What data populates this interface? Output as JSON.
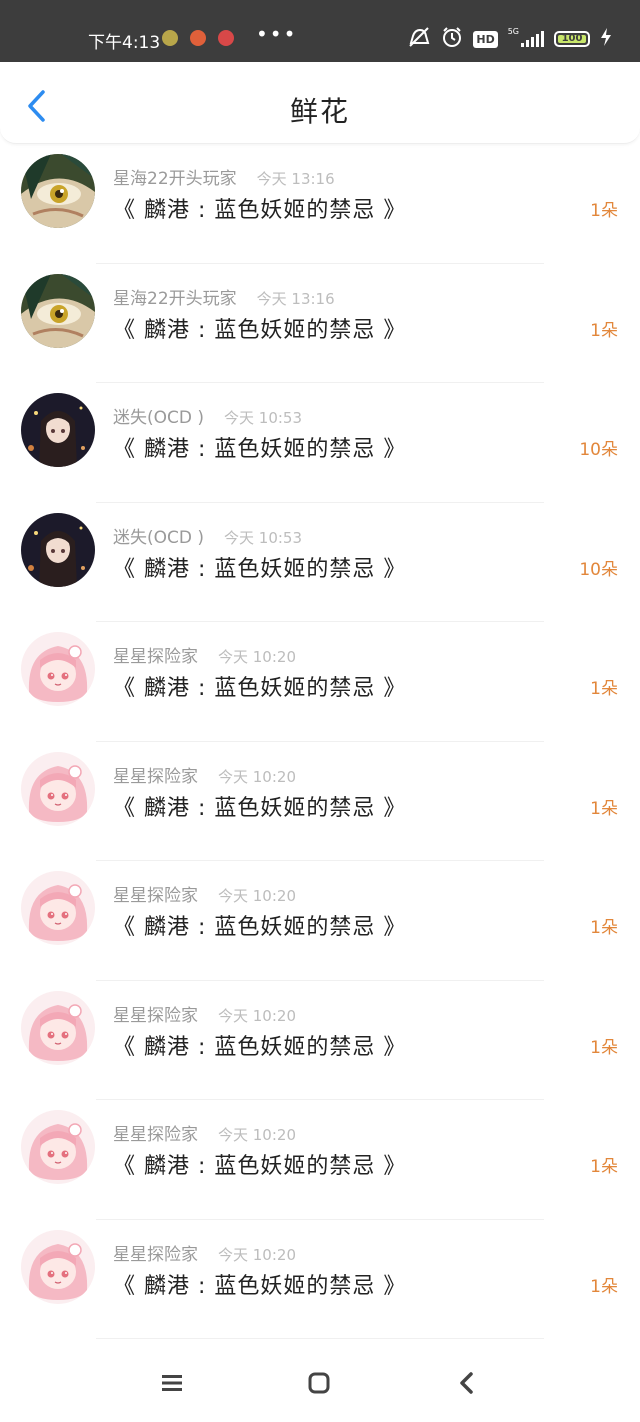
{
  "status_bar": {
    "time": "下午4:13",
    "more": "•••",
    "hd_label": "HD",
    "network_label": "5G",
    "battery_level": "100"
  },
  "header": {
    "title": "鲜花",
    "back_icon": "chevron-left-icon",
    "accent_color": "#2d8cf0"
  },
  "gifts": [
    {
      "user": "星海22开头玩家",
      "time": "今天 13:16",
      "book": "《 麟港 : 蓝色妖姬的禁忌 》",
      "count": "1朵",
      "avatar": "anime-eye"
    },
    {
      "user": "星海22开头玩家",
      "time": "今天 13:16",
      "book": "《 麟港 : 蓝色妖姬的禁忌 》",
      "count": "1朵",
      "avatar": "anime-eye"
    },
    {
      "user": "迷失(OCD )",
      "time": "今天 10:53",
      "book": "《 麟港 : 蓝色妖姬的禁忌 》",
      "count": "10朵",
      "avatar": "dark-hair-girl"
    },
    {
      "user": "迷失(OCD )",
      "time": "今天 10:53",
      "book": "《 麟港 : 蓝色妖姬的禁忌 》",
      "count": "10朵",
      "avatar": "dark-hair-girl"
    },
    {
      "user": "星星探险家",
      "time": "今天 10:20",
      "book": "《 麟港 : 蓝色妖姬的禁忌 》",
      "count": "1朵",
      "avatar": "pink-hair-girl"
    },
    {
      "user": "星星探险家",
      "time": "今天 10:20",
      "book": "《 麟港 : 蓝色妖姬的禁忌 》",
      "count": "1朵",
      "avatar": "pink-hair-girl"
    },
    {
      "user": "星星探险家",
      "time": "今天 10:20",
      "book": "《 麟港 : 蓝色妖姬的禁忌 》",
      "count": "1朵",
      "avatar": "pink-hair-girl"
    },
    {
      "user": "星星探险家",
      "time": "今天 10:20",
      "book": "《 麟港 : 蓝色妖姬的禁忌 》",
      "count": "1朵",
      "avatar": "pink-hair-girl"
    },
    {
      "user": "星星探险家",
      "time": "今天 10:20",
      "book": "《 麟港 : 蓝色妖姬的禁忌 》",
      "count": "1朵",
      "avatar": "pink-hair-girl"
    },
    {
      "user": "星星探险家",
      "time": "今天 10:20",
      "book": "《 麟港 : 蓝色妖姬的禁忌 》",
      "count": "1朵",
      "avatar": "pink-hair-girl"
    }
  ],
  "colors": {
    "count": "#e2873b",
    "username": "#9a9a9a",
    "status_bar": "#3d3d3d"
  },
  "nav": {
    "menu_icon": "menu-icon",
    "home_icon": "home-square-icon",
    "back_icon": "back-triangle-icon"
  }
}
